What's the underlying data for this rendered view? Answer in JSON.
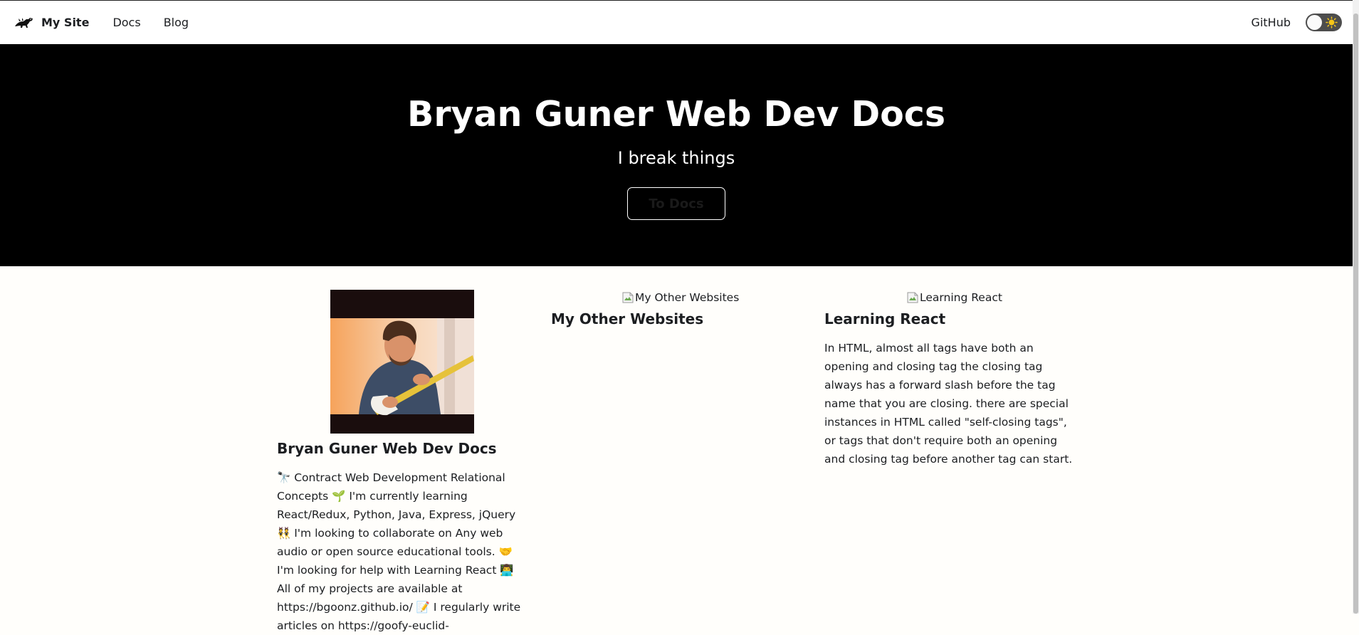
{
  "navbar": {
    "brand_title": "My Site",
    "links": [
      "Docs",
      "Blog"
    ],
    "github_label": "GitHub"
  },
  "hero": {
    "title": "Bryan Guner Web Dev Docs",
    "subtitle": "I break things",
    "button_label": "To Docs"
  },
  "features": [
    {
      "title": "Bryan Guner Web Dev Docs",
      "text": "🔭 Contract Web Development Relational Concepts 🌱 I'm currently learning React/Redux, Python, Java, Express, jQuery 👯 I'm looking to collaborate on Any web audio or open source educational tools. 🤝 I'm looking for help with Learning React 👨‍💻 All of my projects are available at https://bgoonz.github.io/ 📝 I regularly write articles on https://goofy-euclid-"
    },
    {
      "image_alt": "My Other Websites",
      "title": "My Other Websites"
    },
    {
      "image_alt": "Learning React",
      "title": "Learning React",
      "text": "In HTML, almost all tags have both an opening and closing tag the closing tag always has a forward slash before the tag name that you are closing. there are special instances in HTML called \"self-closing tags\", or tags that don't require both an opening and closing tag before another tag can start."
    }
  ],
  "icons": {
    "brand_logo": "dinosaur-logo-icon",
    "theme_toggle": "sun-icon",
    "broken_image": "broken-image-icon"
  },
  "colors": {
    "hero_background": "#000000",
    "hero_text": "#ffffff",
    "page_background": "#fffefb",
    "toggle_track": "#4d4d4d",
    "sun": "#f5c518"
  }
}
